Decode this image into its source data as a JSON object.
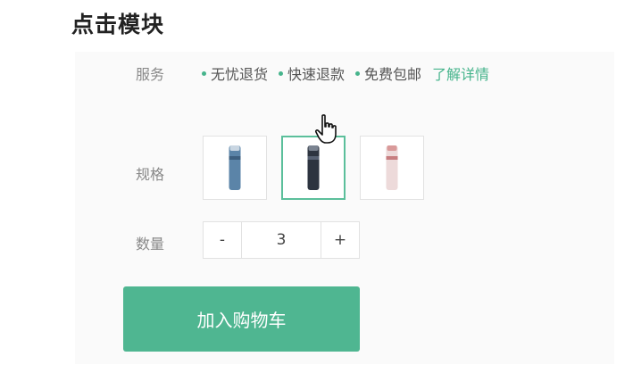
{
  "page": {
    "heading": "点击模块"
  },
  "colors": {
    "accent": "#4fb691",
    "dot": "#46b48c",
    "label": "#888888"
  },
  "service": {
    "label": "服务",
    "items": [
      "无忧退货",
      "快速退款",
      "免费包邮"
    ],
    "link": "了解详情"
  },
  "spec": {
    "label": "规格",
    "options": [
      {
        "name": "blue-bottle",
        "color": "#5b84a8",
        "selected": false
      },
      {
        "name": "black-bottle",
        "color": "#2d3440",
        "selected": true
      },
      {
        "name": "pink-bottle",
        "color": "#e8cfcf",
        "selected": false
      }
    ]
  },
  "quantity": {
    "label": "数量",
    "minus": "-",
    "value": "3",
    "plus": "+"
  },
  "cart": {
    "button_label": "加入购物车"
  },
  "cursor": {
    "icon": "hand-pointer-icon"
  }
}
